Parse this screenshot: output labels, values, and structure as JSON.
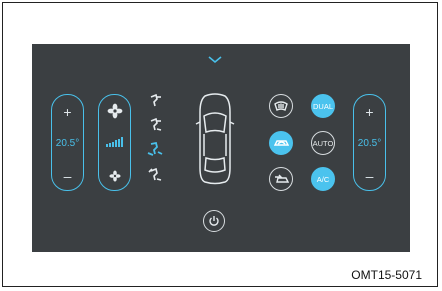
{
  "panel": {
    "left_temp": "20.5°",
    "right_temp": "20.5°",
    "plus_symbol": "+",
    "minus_symbol": "–"
  },
  "buttons": {
    "dual_label": "DUAL",
    "auto_label": "AUTO",
    "ac_label": "A/C"
  },
  "caption": {
    "code": "OMT15-5071"
  },
  "colors": {
    "panel_bg": "#3b3f42",
    "accent": "#49c0ea",
    "icon": "#e6ebee"
  }
}
